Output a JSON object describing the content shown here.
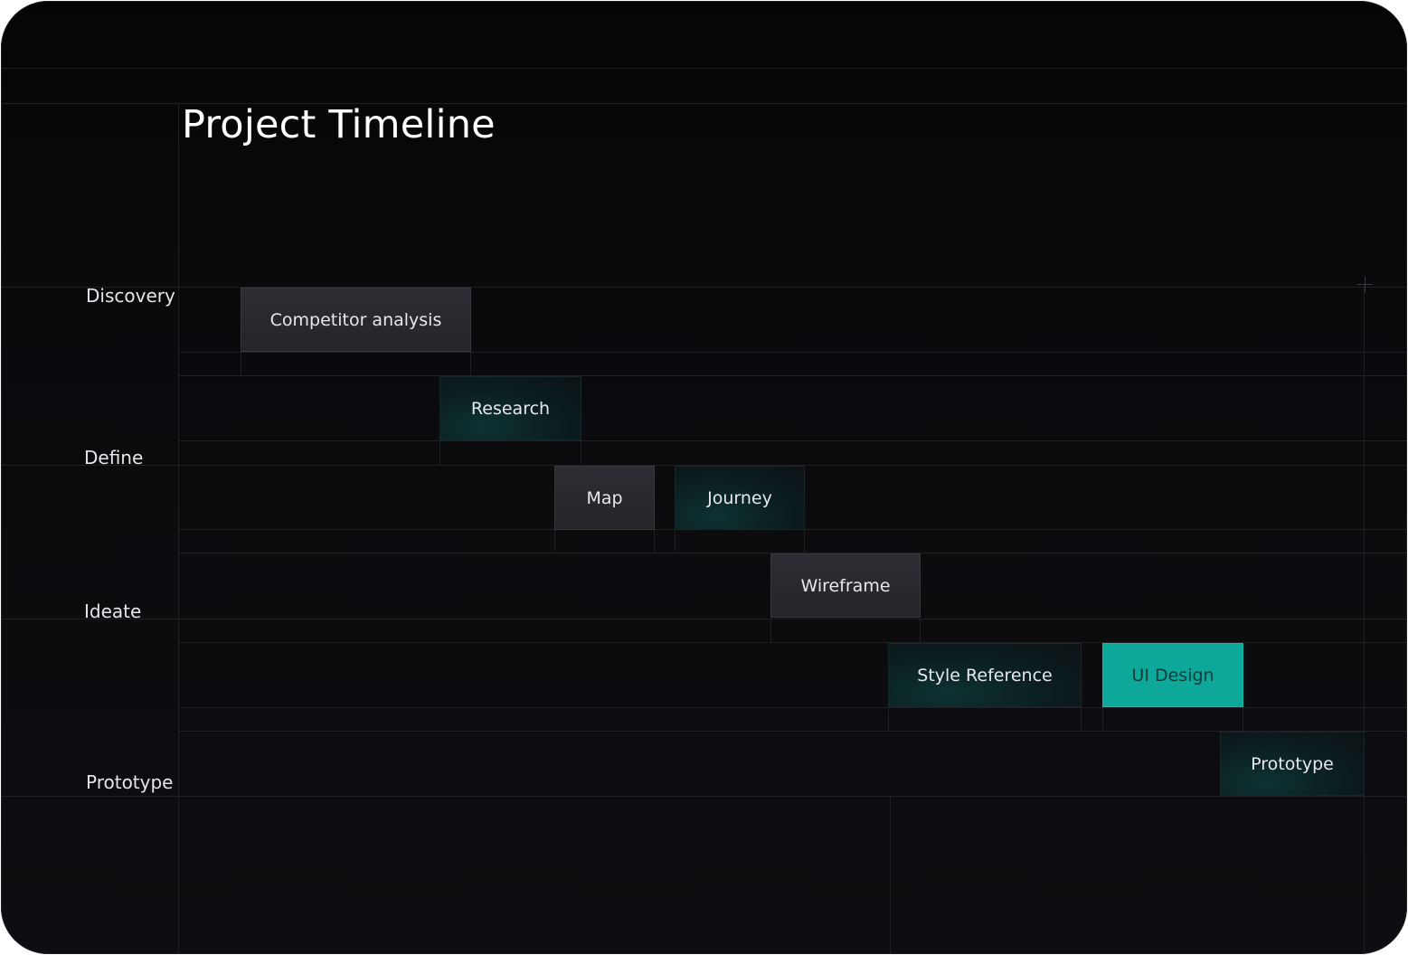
{
  "title": "Project Timeline",
  "phases": {
    "discovery": "Discovery",
    "define": "Define",
    "ideate": "Ideate",
    "prototype": "Prototype"
  },
  "tasks": {
    "competitor_analysis": "Competitor analysis",
    "research": "Research",
    "map": "Map",
    "journey": "Journey",
    "wireframe": "Wireframe",
    "style_reference": "Style Reference",
    "ui_design": "UI Design",
    "prototype": "Prototype"
  },
  "icons": {
    "add": "plus-icon"
  },
  "colors": {
    "background": "#0a0a0d",
    "grey_task": "#2e2d33",
    "dark_teal_task": "#0b1d1f",
    "accent_teal": "#0ea89a",
    "text": "#ffffff"
  }
}
